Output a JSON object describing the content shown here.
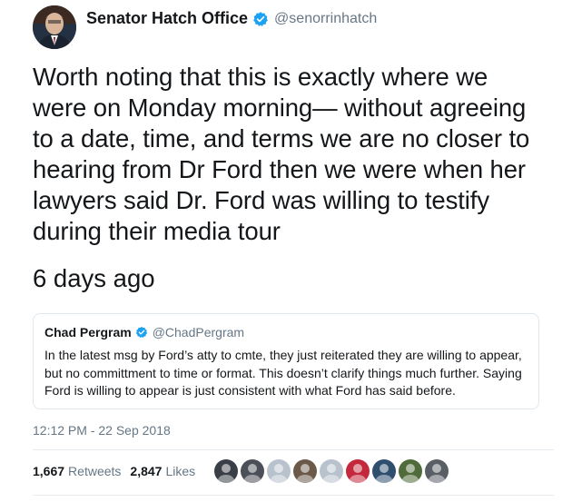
{
  "author": {
    "display_name": "Senator Hatch Office",
    "handle": "@senorrinhatch",
    "avatar_icon": "profile-photo",
    "verified_icon": "verified-badge-icon"
  },
  "tweet": {
    "lines": [
      "Worth noting that this is exactly where we",
      "were on Monday morning— without agreeing",
      "to a date, time, and terms we are no closer to",
      "hearing from Dr Ford then we were when her",
      "lawyers said Dr. Ford was willing to testify",
      "during their media tour"
    ],
    "time_ago": "6 days ago"
  },
  "quoted_tweet": {
    "display_name": "Chad Pergram",
    "handle": "@ChadPergram",
    "lines": [
      "In the latest msg by Ford’s atty to cmte, they just reiterated they are willing to appear,",
      "but no committment to time or format. This doesn’t clarify things much further.  Saying",
      "Ford is willing to appear is just consistent with what Ford has said before."
    ]
  },
  "timestamp": "12:12 PM - 22 Sep 2018",
  "stats": {
    "retweets_count": "1,667",
    "retweets_label": "Retweets",
    "likes_count": "2,847",
    "likes_label": "Likes"
  },
  "likers": [
    {
      "name": "liker-avatar-1",
      "color": "#3a3f47"
    },
    {
      "name": "liker-avatar-2",
      "color": "#4b4f58"
    },
    {
      "name": "liker-avatar-3",
      "color": "#b8c2cc"
    },
    {
      "name": "liker-avatar-4",
      "color": "#6b5a4a"
    },
    {
      "name": "liker-avatar-5",
      "color": "#b8c2cc"
    },
    {
      "name": "liker-avatar-6",
      "color": "#c4283c"
    },
    {
      "name": "liker-avatar-7",
      "color": "#2f4f6f"
    },
    {
      "name": "liker-avatar-8",
      "color": "#4f6b3a"
    },
    {
      "name": "liker-avatar-9",
      "color": "#5a5f66"
    }
  ],
  "colors": {
    "verified_blue": "#1da1f2",
    "secondary_text": "#657786",
    "border": "#e1e8ed"
  }
}
